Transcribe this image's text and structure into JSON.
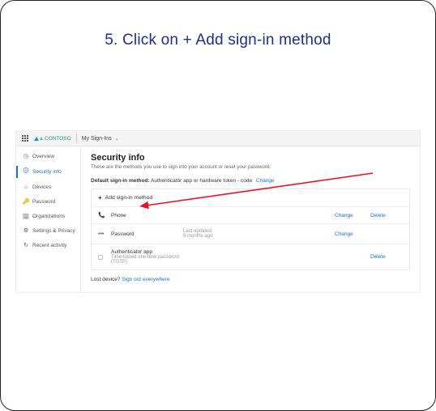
{
  "instruction_text": "5. Click on + Add sign-in method",
  "topbar": {
    "brand": "CONTOSO",
    "page_title": "My Sign-Ins"
  },
  "sidebar": {
    "items": [
      {
        "icon": "overview-icon",
        "glyph": "◷",
        "label": "Overview"
      },
      {
        "icon": "security-icon",
        "glyph": "🛈",
        "label": "Security info"
      },
      {
        "icon": "devices-icon",
        "glyph": "⌂",
        "label": "Devices"
      },
      {
        "icon": "password-icon",
        "glyph": "🔑",
        "label": "Password"
      },
      {
        "icon": "organizations-icon",
        "glyph": "🏢",
        "label": "Organizations"
      },
      {
        "icon": "settings-icon",
        "glyph": "⚙",
        "label": "Settings & Privacy"
      },
      {
        "icon": "activity-icon",
        "glyph": "↻",
        "label": "Recent activity"
      }
    ]
  },
  "main": {
    "heading": "Security info",
    "subheading": "These are the methods you use to sign into your account or reset your password.",
    "default_label": "Default sign-in method:",
    "default_value": "Authenticator app or hardware token - code",
    "default_change": "Change",
    "add_method_label": "Add sign-in method",
    "methods": [
      {
        "icon_glyph": "📞",
        "name": "Phone",
        "meta_line1": "",
        "meta_line2": "",
        "action1": "Change",
        "action2": "Delete"
      },
      {
        "icon_glyph": "•••",
        "name": "Password",
        "meta_line1": "Last updated:",
        "meta_line2": "9 months ago",
        "action1": "Change",
        "action2": ""
      },
      {
        "icon_glyph": "▢",
        "name": "Authenticator app",
        "meta_line1": "Time-based one-time password (TOTP)",
        "meta_line2": "",
        "action1": "",
        "action2": "Delete"
      }
    ],
    "lost_device_label": "Lost device?",
    "lost_device_link": "Sign out everywhere"
  }
}
